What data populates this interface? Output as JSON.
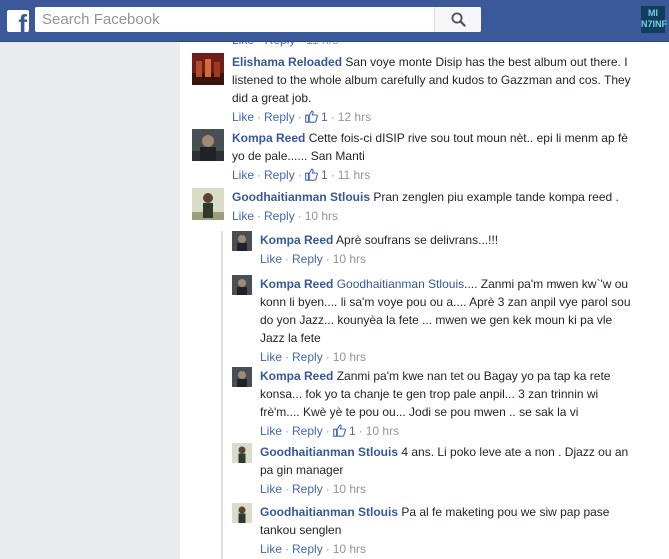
{
  "header": {
    "logo": "f",
    "search_placeholder": "Search Facebook",
    "corner_logo": "MI\nN7INF",
    "brand_color": "#3b5998"
  },
  "comments": [
    {
      "author": "Elishama Reloaded",
      "mention": "",
      "text": "San voye monte Disip has the best album out there. I listened to the whole album carefully and kudos to Gazzman and cos. They did a great job.",
      "like": "Like",
      "reply": "Reply",
      "likes": "1",
      "time": "12 hrs"
    },
    {
      "author": "Kompa Reed",
      "mention": "",
      "text": "Cette fois-ci dISIP rive sou tout moun nèt.. epi li menm ap fè yo de pale...... San Manti",
      "like": "Like",
      "reply": "Reply",
      "likes": "1",
      "time": "11 hrs"
    },
    {
      "author": "Goodhaitianman Stlouis",
      "mention": "",
      "text": "Pran zenglen piu example tande kompa reed .",
      "like": "Like",
      "reply": "Reply",
      "likes": "",
      "time": "10 hrs"
    }
  ],
  "replies": [
    {
      "author": "Kompa Reed",
      "mention": "",
      "text": "Aprè soufrans se delivrans...!!!",
      "like": "Like",
      "reply": "Reply",
      "likes": "",
      "time": "10 hrs"
    },
    {
      "author": "Kompa Reed",
      "mention": "Goodhaitianman Stlouis",
      "text": ".... Zanmi pa'm mwen kw`'w ou konn li byen.... li sa'm voye pou ou a.... Aprè 3 zan anpil vye parol sou do yon Jazz... kounyèa la fete ... mwen we gen kek moun ki pa vle Jazz la fete",
      "like": "Like",
      "reply": "Reply",
      "likes": "",
      "time": "10 hrs"
    },
    {
      "author": "Kompa Reed",
      "mention": "",
      "text": "Zanmi pa'm kwe nan tet ou Bagay yo pa tap ka rete konsa... fok yo ta chanje te gen trop pale anpil... 3 zan trinnin wi frè'm.... Kwè yè te pou ou... Jodi se pou mwen .. se sak la vi",
      "like": "Like",
      "reply": "Reply",
      "likes": "1",
      "time": "10 hrs"
    },
    {
      "author": "Goodhaitianman Stlouis",
      "mention": "",
      "text": "4 ans. Li poko leve ate a non . Djazz ou an pa gin manager",
      "like": "Like",
      "reply": "Reply",
      "likes": "",
      "time": "10 hrs"
    },
    {
      "author": "Goodhaitianman Stlouis",
      "mention": "",
      "text": "Pa al fe maketing pou we siw pap pase tankou senglen",
      "like": "Like",
      "reply": "Reply",
      "likes": "",
      "time": "10 hrs"
    }
  ]
}
